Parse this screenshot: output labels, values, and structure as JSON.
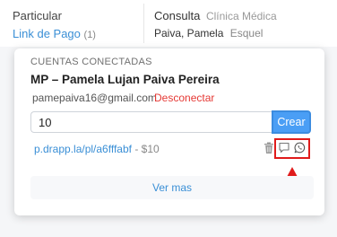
{
  "background": {
    "payment_type": "Particular",
    "payment_link_label": "Link de Pago",
    "payment_link_count": "(1)",
    "consult_label": "Consulta",
    "consult_value": "Clínica Médica",
    "patient_name": "Paiva, Pamela",
    "patient_city": "Esquel"
  },
  "popup": {
    "caption": "CUENTAS CONECTADAS",
    "account_name": "MP – Pamela Lujan Paiva Pereira",
    "email": "pamepaiva16@gmail.com",
    "disconnect_label": "Desconectar",
    "amount_value": "10",
    "create_label": "Crear",
    "link_url": "p.drapp.la/pl/a6fffabf",
    "link_price": " - $10",
    "see_more_label": "Ver mas"
  },
  "icons": {
    "delete": "trash-icon",
    "message": "message-icon",
    "whatsapp": "whatsapp-icon",
    "annotation_arrow": "arrow-up-icon"
  },
  "colors": {
    "accent": "#4a9ef5",
    "link": "#3a8fd6",
    "danger": "#e53935",
    "annotation": "#e01b1b"
  }
}
